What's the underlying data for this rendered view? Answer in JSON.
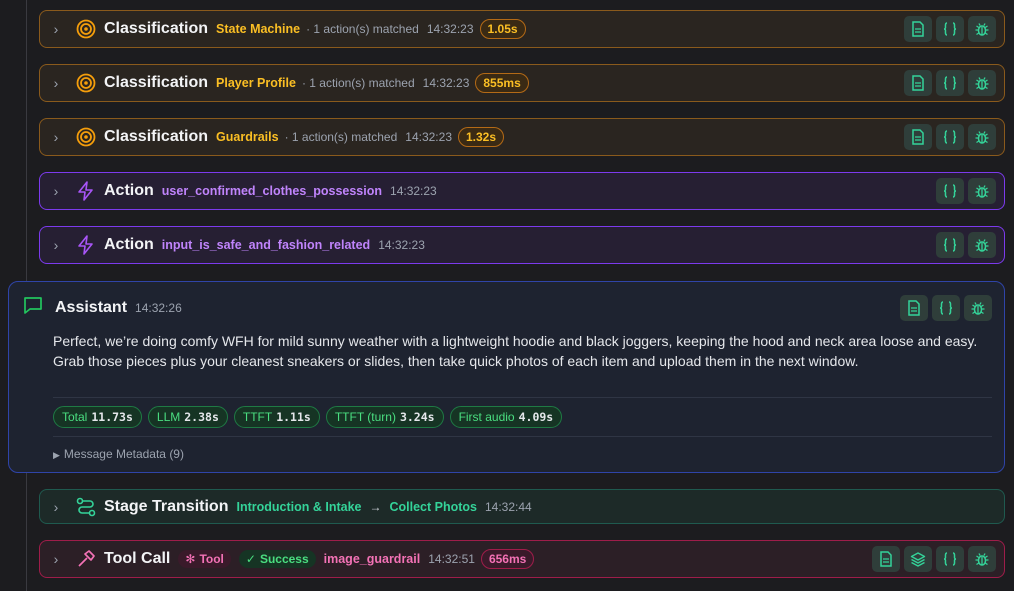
{
  "colors": {
    "classification": "#f59e0b",
    "action": "#a855f7",
    "stage": "#34d399",
    "tool": "#f472b6",
    "assistant": "#22c55e"
  },
  "rows": [
    {
      "kind": "Classification",
      "sub": "State Machine",
      "meta": "· 1 action(s) matched",
      "time": "14:32:23",
      "duration": "1.05s",
      "icon": "target-icon"
    },
    {
      "kind": "Classification",
      "sub": "Player Profile",
      "meta": "· 1 action(s) matched",
      "time": "14:32:23",
      "duration": "855ms",
      "icon": "target-icon"
    },
    {
      "kind": "Classification",
      "sub": "Guardrails",
      "meta": "· 1 action(s) matched",
      "time": "14:32:23",
      "duration": "1.32s",
      "icon": "target-icon"
    },
    {
      "kind": "Action",
      "sub": "user_confirmed_clothes_possession",
      "time": "14:32:23",
      "icon": "bolt-icon"
    },
    {
      "kind": "Action",
      "sub": "input_is_safe_and_fashion_related",
      "time": "14:32:23",
      "icon": "bolt-icon"
    }
  ],
  "assistant": {
    "title": "Assistant",
    "time": "14:32:26",
    "message": "Perfect, we’re doing comfy WFH for mild sunny weather with a lightweight hoodie and black joggers, keeping the hood and neck area loose and easy. Grab those pieces plus your cleanest sneakers or slides, then take quick photos of each item and upload them in the next window.",
    "metrics": [
      {
        "label": "Total",
        "value": "11.73s"
      },
      {
        "label": "LLM",
        "value": "2.38s"
      },
      {
        "label": "TTFT",
        "value": "1.11s"
      },
      {
        "label": "TTFT (turn)",
        "value": "3.24s"
      },
      {
        "label": "First audio",
        "value": "4.09s"
      }
    ],
    "metadata_label": "Message Metadata (9)"
  },
  "stage": {
    "title": "Stage Transition",
    "from": "Introduction & Intake",
    "arrow": "→",
    "to": "Collect Photos",
    "time": "14:32:44"
  },
  "tool": {
    "title": "Tool Call",
    "type_badge": "Tool",
    "status": "Success",
    "name": "image_guardrail",
    "time": "14:32:51",
    "duration": "656ms"
  }
}
